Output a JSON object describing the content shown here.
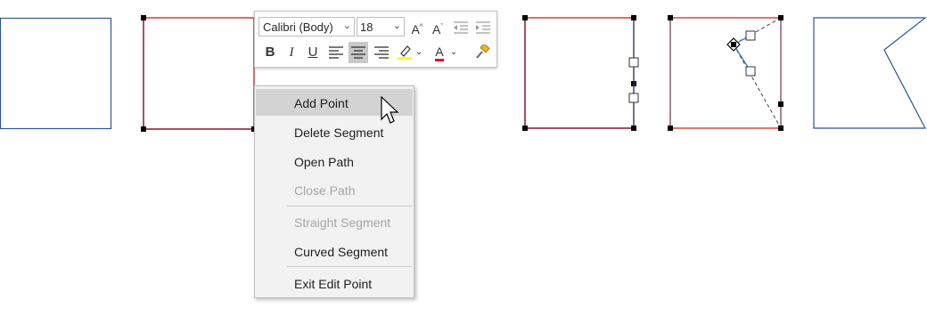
{
  "toolbar": {
    "font_name": "Calibri (Body)",
    "font_size": "18",
    "grow_font": "A",
    "shrink_font": "A",
    "bold": "B",
    "italic": "I",
    "underline": "U",
    "font_color_letter": "A",
    "highlight_color": "#ffff00",
    "font_color": "#e81123"
  },
  "context_menu": {
    "items": [
      {
        "label": "Add Point",
        "enabled": true,
        "highlighted": true
      },
      {
        "label": "Delete Segment",
        "enabled": true
      },
      {
        "label": "Open Path",
        "enabled": true
      },
      {
        "label": "Close Path",
        "enabled": false
      },
      {
        "label": "Straight Segment",
        "enabled": false
      },
      {
        "label": "Curved Segment",
        "enabled": true
      },
      {
        "label": "Exit Edit Point",
        "enabled": true
      }
    ]
  },
  "colors": {
    "shape_outline": "#2f5597",
    "edit_path": "#e0443a",
    "vertex": "#000000"
  }
}
